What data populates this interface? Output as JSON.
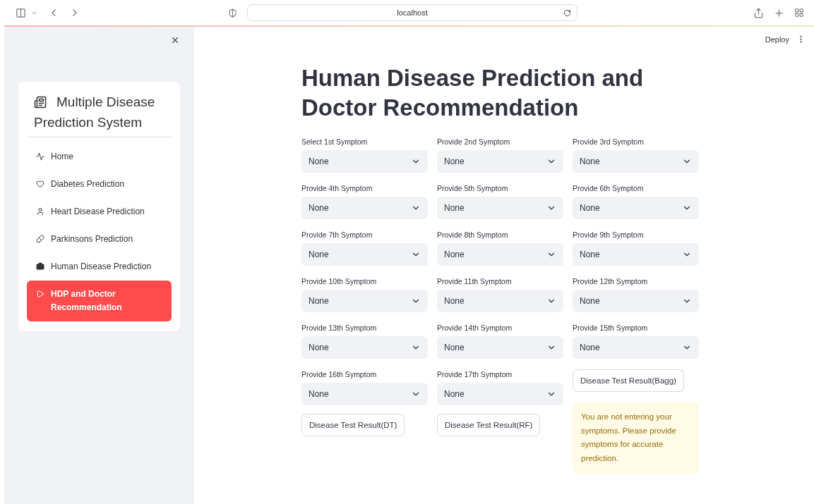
{
  "browser": {
    "address": "localhost"
  },
  "sidebar": {
    "title": "Multiple Disease Prediction System",
    "items": [
      {
        "label": "Home",
        "selected": false
      },
      {
        "label": "Diabetes Prediction",
        "selected": false
      },
      {
        "label": "Heart Disease Prediction",
        "selected": false
      },
      {
        "label": "Parkinsons Prediction",
        "selected": false
      },
      {
        "label": "Human Disease Prediction",
        "selected": false
      },
      {
        "label": "HDP and Doctor Recommendation",
        "selected": true
      }
    ]
  },
  "header": {
    "deploy": "Deploy"
  },
  "title": "Human Disease Prediction and Doctor Recommendation",
  "columns": [
    {
      "fields": [
        {
          "label": "Select 1st Symptom",
          "value": "None"
        },
        {
          "label": "Provide 4th Symptom",
          "value": "None"
        },
        {
          "label": "Provide 7th Symptom",
          "value": "None"
        },
        {
          "label": "Provide 10th Symptom",
          "value": "None"
        },
        {
          "label": "Provide 13th Symptom",
          "value": "None"
        },
        {
          "label": "Provide 16th Symptom",
          "value": "None"
        }
      ],
      "button": "Disease Test Result(DT)"
    },
    {
      "fields": [
        {
          "label": "Provide 2nd Symptom",
          "value": "None"
        },
        {
          "label": "Provide 5th Symptom",
          "value": "None"
        },
        {
          "label": "Provide 8th Symptom",
          "value": "None"
        },
        {
          "label": "Provide 11th Symptom",
          "value": "None"
        },
        {
          "label": "Provide 14th Symptom",
          "value": "None"
        },
        {
          "label": "Provide 17th Symptom",
          "value": "None"
        }
      ],
      "button": "Disease Test Result(RF)"
    },
    {
      "fields": [
        {
          "label": "Provide 3rd Symptom",
          "value": "None"
        },
        {
          "label": "Provide 6th Symptom",
          "value": "None"
        },
        {
          "label": "Provide 9th Symptom",
          "value": "None"
        },
        {
          "label": "Provide 12th Symptom",
          "value": "None"
        },
        {
          "label": "Provide 15th Symptom",
          "value": "None"
        }
      ],
      "button": "Disease Test Result(Bagg)",
      "warning": "You are not entering your symptoms. Please provide symptoms for accurate prediction."
    }
  ]
}
